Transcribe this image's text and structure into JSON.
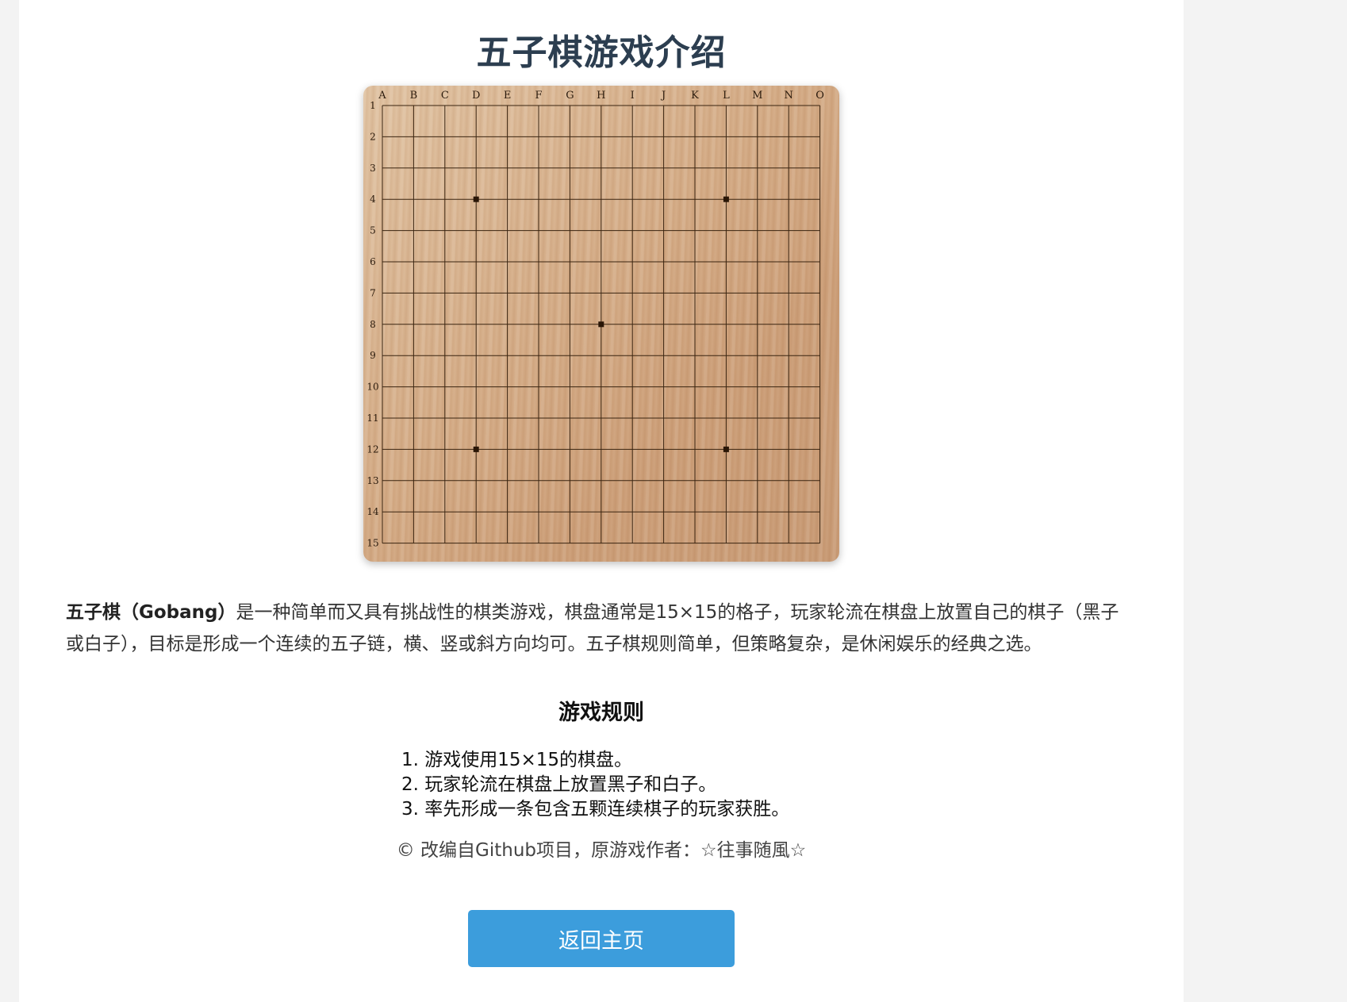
{
  "page": {
    "title": "五子棋游戏介绍"
  },
  "board": {
    "columns": [
      "A",
      "B",
      "C",
      "D",
      "E",
      "F",
      "G",
      "H",
      "I",
      "J",
      "K",
      "L",
      "M",
      "N",
      "O"
    ],
    "rows": [
      "1",
      "2",
      "3",
      "4",
      "5",
      "6",
      "7",
      "8",
      "9",
      "10",
      "11",
      "12",
      "13",
      "14",
      "15"
    ],
    "star_points": [
      "D4",
      "L4",
      "H8",
      "D12",
      "L12"
    ]
  },
  "intro": {
    "bold_term": "五子棋（Gobang）",
    "text": "是一种简单而又具有挑战性的棋类游戏，棋盘通常是15×15的格子，玩家轮流在棋盘上放置自己的棋子（黑子或白子），目标是形成一个连续的五子链，横、竖或斜方向均可。五子棋规则简单，但策略复杂，是休闲娱乐的经典之选。"
  },
  "rules": {
    "title": "游戏规则",
    "items": [
      "1. 游戏使用15×15的棋盘。",
      "2. 玩家轮流在棋盘上放置黑子和白子。",
      "3. 率先形成一条包含五颗连续棋子的玩家获胜。"
    ]
  },
  "credit": "© 改编自Github项目，原游戏作者：☆往事随風☆",
  "buttons": {
    "home": "返回主页"
  },
  "colors": {
    "title": "#2c3e50",
    "button": "#3c9ddc",
    "grid": "#3a2410"
  }
}
